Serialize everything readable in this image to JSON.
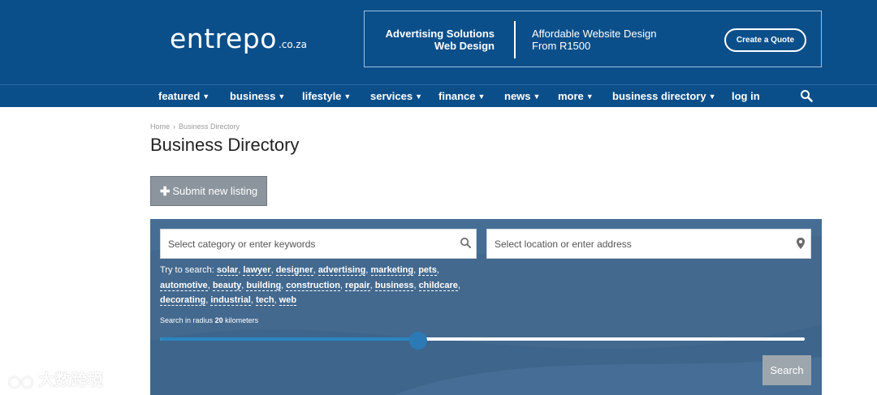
{
  "header": {
    "logo": "entrepo",
    "logo_suffix": ".co.za",
    "ad": {
      "left_line1": "Advertising Solutions",
      "left_line2": "Web Design",
      "right_line1": "Affordable Website Design",
      "right_line2": "From R1500",
      "cta": "Create a Quote"
    }
  },
  "nav": {
    "items": [
      {
        "label": "featured"
      },
      {
        "label": "business"
      },
      {
        "label": "lifestyle"
      },
      {
        "label": "services"
      },
      {
        "label": "finance"
      },
      {
        "label": "news"
      },
      {
        "label": "more"
      },
      {
        "label": "business directory"
      },
      {
        "label": "log in"
      }
    ],
    "search_icon": "search-icon"
  },
  "breadcrumb": {
    "home": "Home",
    "separator": "›",
    "current": "Business Directory"
  },
  "page": {
    "title": "Business Directory",
    "submit_label": "Submit new listing"
  },
  "search": {
    "keyword_placeholder": "Select category or enter keywords",
    "location_placeholder": "Select location or enter address",
    "try_label": "Try to search:",
    "keywords": [
      "solar",
      "lawyer",
      "designer",
      "advertising",
      "marketing",
      "pets",
      "automotive",
      "beauty",
      "building",
      "construction",
      "repair",
      "business",
      "childcare",
      "decorating",
      "industrial",
      "tech",
      "web"
    ],
    "radius_label": "Search in radius",
    "radius_value": "20",
    "radius_unit": "kilometers",
    "radius_fraction": 0.4,
    "button": "Search"
  },
  "watermark": "大数跨境",
  "colors": {
    "brand": "#0b4f8a",
    "panel": "#43698f",
    "slider": "#2b7ab5"
  }
}
